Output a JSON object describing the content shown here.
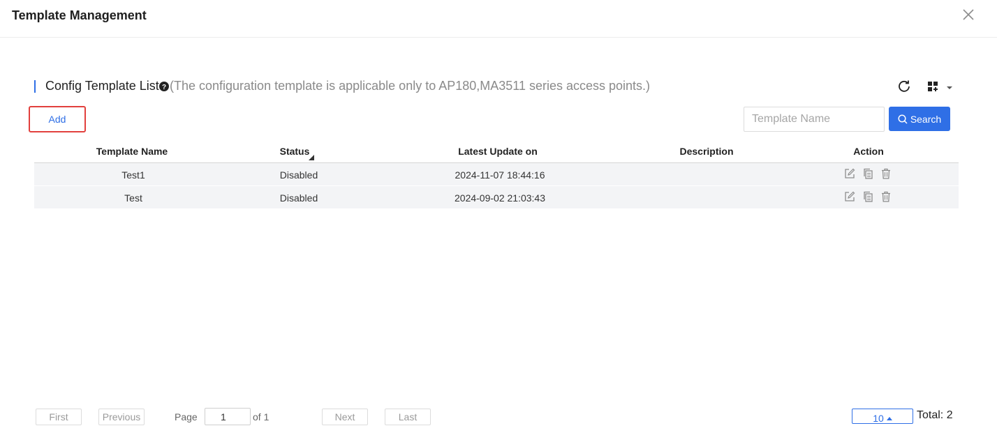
{
  "dialog": {
    "title": "Template Management"
  },
  "section": {
    "title": "Config Template List",
    "note": "(The configuration template is applicable only to AP180,MA3511 series access points.)"
  },
  "toolbar": {
    "add_label": "Add",
    "search_placeholder": "Template Name",
    "search_value": "",
    "search_label": "Search"
  },
  "table": {
    "columns": [
      "Template Name",
      "Status",
      "Latest Update on",
      "Description",
      "Action"
    ],
    "rows": [
      {
        "name": "Test1",
        "status": "Disabled",
        "updated": "2024-11-07 18:44:16",
        "description": ""
      },
      {
        "name": "Test",
        "status": "Disabled",
        "updated": "2024-09-02 21:03:43",
        "description": ""
      }
    ]
  },
  "pagination": {
    "first": "First",
    "previous": "Previous",
    "page_label": "Page",
    "page_value": "1",
    "of_label": "of 1",
    "next": "Next",
    "last": "Last",
    "page_size": "10",
    "total": "Total: 2"
  },
  "colors": {
    "accent": "#2f6fe6",
    "highlight_border": "#e2403d",
    "row_background": "#f3f4f6"
  },
  "icons": {
    "close": "close-icon",
    "help": "question-circle-icon",
    "refresh": "refresh-icon",
    "columns": "grid-settings-icon",
    "search": "search-icon",
    "edit": "edit-icon",
    "copy": "copy-icon",
    "delete": "trash-icon"
  }
}
